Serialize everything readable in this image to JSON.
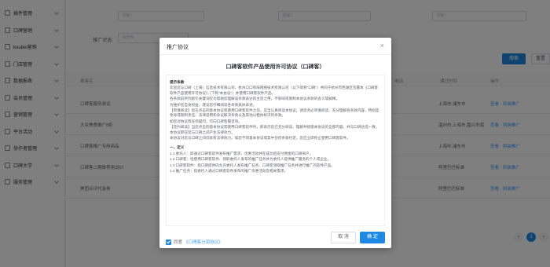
{
  "sidebar": {
    "items": [
      {
        "label": "插件管理"
      },
      {
        "label": "口碑营销"
      },
      {
        "label": "koubei营销"
      },
      {
        "label": "门店管理"
      },
      {
        "label": "数据报表"
      },
      {
        "label": "会员管理"
      },
      {
        "label": "营销管理"
      },
      {
        "label": "平台活动"
      },
      {
        "label": "协作者管理"
      },
      {
        "label": "口碑大学"
      },
      {
        "label": "服务管理"
      }
    ]
  },
  "filters": {
    "row1": [
      {
        "label": "手机号:",
        "placeholder": "请输入"
      },
      {
        "label": "所属商家:",
        "placeholder": "请输入"
      },
      {
        "label": "店铺名称:",
        "placeholder": "请输入"
      }
    ],
    "row2": [
      {
        "label": "推广状态:",
        "placeholder": "请选择"
      }
    ],
    "search_label": "搜索",
    "reset_label": "重置"
  },
  "table": {
    "headers": [
      "推客名",
      "电话",
      "通过时间",
      "操作"
    ],
    "rows": [
      {
        "name": "口碑客服务测试",
        "location": "上海市,浦东市",
        "action": "查看 · 拼装推广"
      },
      {
        "name": "大众美食推广8折",
        "location": "温州市,上海市,嘉兴市南",
        "action": "查看 · 拼装推广"
      },
      {
        "name": "口碑客推广专用商品",
        "location": "上海市,浦东市",
        "action": "查看 · 拼装推广"
      },
      {
        "name": "口碑客二期推荐测试07",
        "location": "阿里巴巴标准",
        "action": "查看 · 拼装推广"
      },
      {
        "name": "美团点评代金券",
        "location": "阿里巴巴标准",
        "action": "查看 · 拼装推广"
      }
    ]
  },
  "pager": {
    "prev": "‹",
    "current": "1",
    "next": "›"
  },
  "modal": {
    "title": "推广协议",
    "close": "×",
    "doc_title": "口碑客软件产品使用许可协议（口碑客）",
    "lines": [
      {
        "text": "提示条款",
        "head": true
      },
      {
        "text": "欢迎您与口碑（上海）信息技术有限公司、杭州口口有味网络技术有限公司（以下简称\"口碑\"）共同于杭州市西湖区签署本《口碑客软件产品使用许可协议》（下称\"本协议\"）并使用口碑客软件产品。"
      },
      {
        "text": "各条款前所列索引关键词仅为帮助您理解该条款表达的主旨之用，不影响或限制本协议条款的含义或解释。"
      },
      {
        "text": "为维护您自身权益，建议您仔细阅读各条款具体表述。"
      },
      {
        "text": "【审慎阅读】您在点击同意本协议或使用口碑客软件之前，应当认真阅读本协议。请您务必审慎阅读、充分理解各条款内容，特别是免除或限制责任、法律适用和争议解决条款以及其他以粗体标识的条款。"
      },
      {
        "text": "如您对协议有任何疑问，可向口碑客服咨询。"
      },
      {
        "text": "【签约阅读】当您点击同意本协议或使用口碑客软件时，即表示您已充分阅读、理解并接受本协议的全部内容，并与口碑达成一致，本协议即在您与口碑之间产生法律效力。"
      },
      {
        "text": "本协议对您与口碑之间均具有法律效力。如您不同意本协议或其中任何条款约定，您应立即停止使用口碑客软件。"
      },
      {
        "text": "",
        "gap": true
      },
      {
        "text": "一、定义",
        "head": true
      },
      {
        "text": "1.1 委托人：即通过口碑客软件发布推广需求、优惠活动并在成功后支付佣金的口碑商户。"
      },
      {
        "text": "1.2 口碑客：指使用口碑客软件、领取委托人发布的推广任务并为委托人提供推广服务的个人或企业。"
      },
      {
        "text": "1.3 口碑客软件：指口碑提供的允许委托人发布推广任务、口碑客领取推广任务并进行推广的软件产品。"
      },
      {
        "text": "1.4 推广任务：指委托人通过口碑客软件发布的推广优惠活动及相关需求。"
      }
    ],
    "agree_label": "同意",
    "agree_link": "《口碑客分润协议》",
    "cancel_label": "取 消",
    "ok_label": "确 定"
  }
}
